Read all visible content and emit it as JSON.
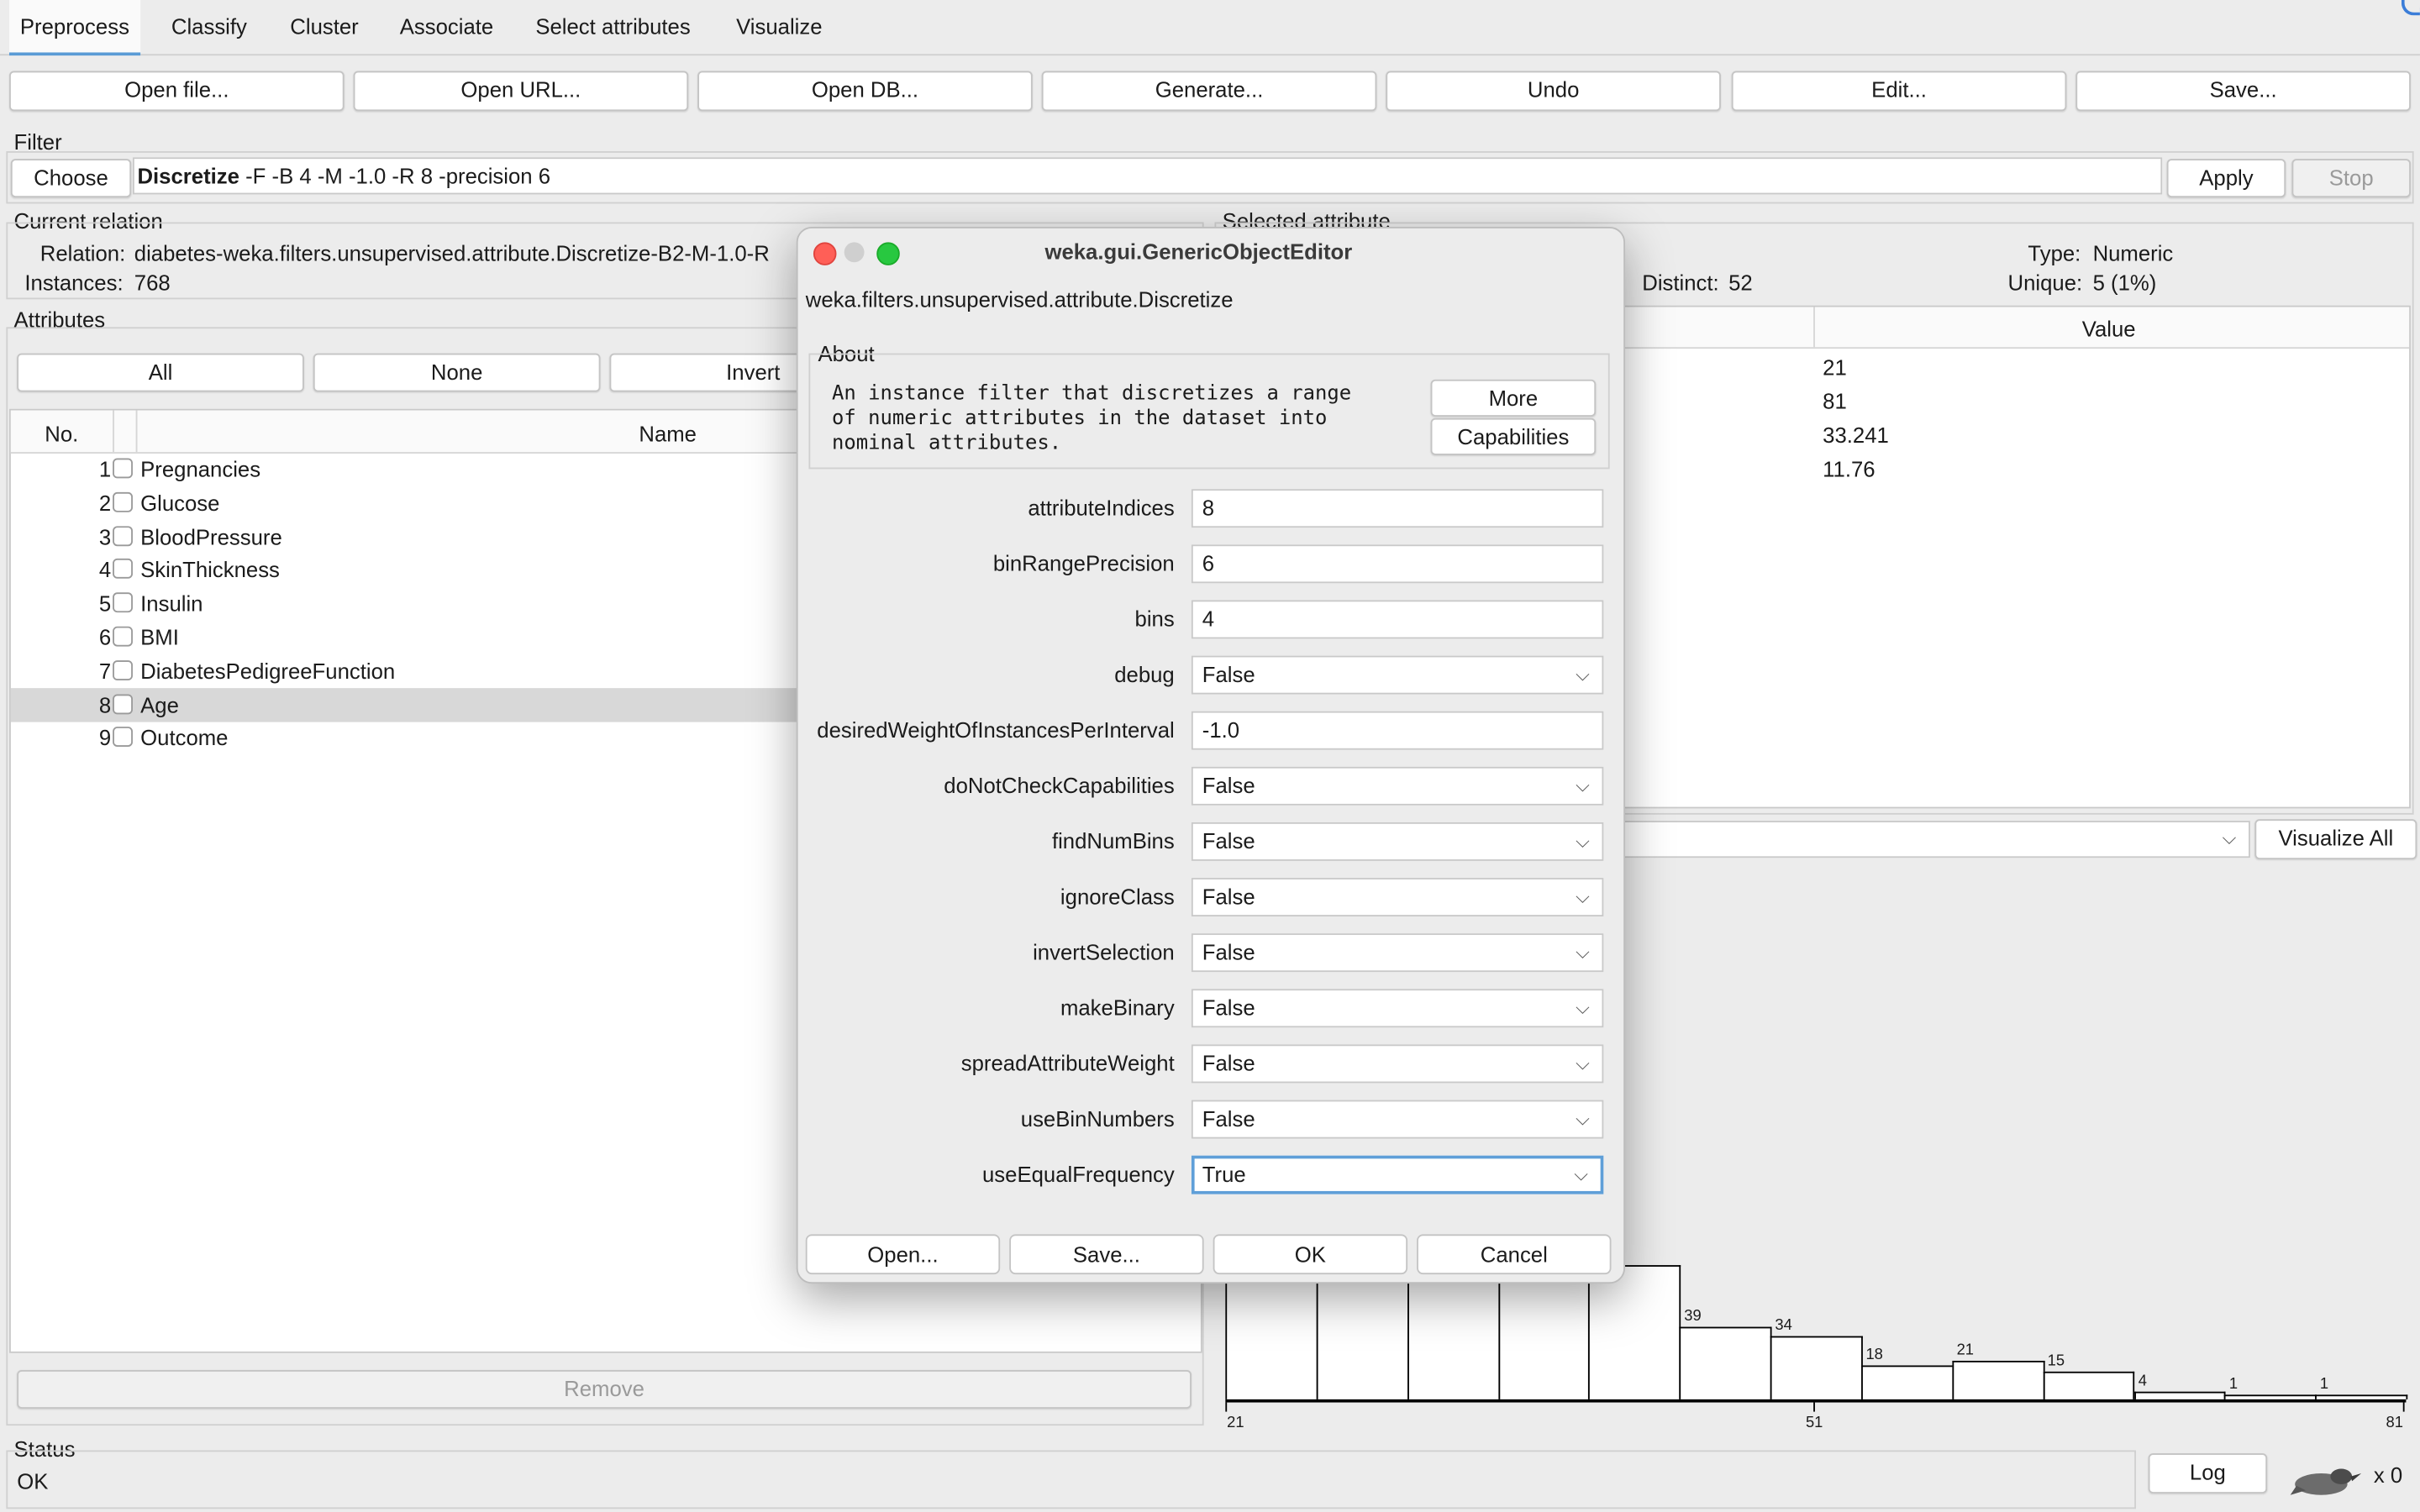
{
  "tabs": [
    "Preprocess",
    "Classify",
    "Cluster",
    "Associate",
    "Select attributes",
    "Visualize"
  ],
  "toolbar": [
    "Open file...",
    "Open URL...",
    "Open DB...",
    "Generate...",
    "Undo",
    "Edit...",
    "Save..."
  ],
  "filter": {
    "section_label": "Filter",
    "choose_label": "Choose",
    "name": "Discretize",
    "options": " -F -B 4 -M -1.0 -R 8 -precision 6",
    "apply_label": "Apply",
    "stop_label": "Stop"
  },
  "current_relation": {
    "title": "Current relation",
    "relation_label": "Relation:",
    "relation_value": "diabetes-weka.filters.unsupervised.attribute.Discretize-B2-M-1.0-R",
    "instances_label": "Instances:",
    "instances_value": "768"
  },
  "attributes": {
    "title": "Attributes",
    "buttons": [
      "All",
      "None",
      "Invert"
    ],
    "col_no": "No.",
    "col_name": "Name",
    "rows": [
      {
        "no": "1",
        "name": "Pregnancies"
      },
      {
        "no": "2",
        "name": "Glucose"
      },
      {
        "no": "3",
        "name": "BloodPressure"
      },
      {
        "no": "4",
        "name": "SkinThickness"
      },
      {
        "no": "5",
        "name": "Insulin"
      },
      {
        "no": "6",
        "name": "BMI"
      },
      {
        "no": "7",
        "name": "DiabetesPedigreeFunction"
      },
      {
        "no": "8",
        "name": "Age"
      },
      {
        "no": "9",
        "name": "Outcome"
      }
    ],
    "selected_index": 7,
    "remove_label": "Remove"
  },
  "selected_attribute": {
    "title": "Selected attribute",
    "distinct_label": "Distinct:",
    "distinct_value": "52",
    "type_label": "Type:",
    "type_value": "Numeric",
    "unique_label": "Unique:",
    "unique_value": "5 (1%)",
    "value_header": "Value",
    "stats_values": [
      "21",
      "81",
      "33.241",
      "11.76"
    ],
    "visualize_all_label": "Visualize All"
  },
  "histogram": {
    "counts": [
      null,
      null,
      null,
      null,
      null,
      39,
      34,
      18,
      21,
      15,
      4,
      1,
      1
    ],
    "axis_ticks": [
      "21",
      "51",
      "81"
    ]
  },
  "status": {
    "title": "Status",
    "text": "OK",
    "log_label": "Log",
    "x_count": "x 0"
  },
  "dialog": {
    "title": "weka.gui.GenericObjectEditor",
    "class_name": "weka.filters.unsupervised.attribute.Discretize",
    "about_title": "About",
    "about_text": "An instance filter that discretizes a range of numeric attributes in the dataset into nominal attributes.",
    "more_label": "More",
    "capabilities_label": "Capabilities",
    "params": [
      {
        "label": "attributeIndices",
        "value": "8",
        "kind": "text"
      },
      {
        "label": "binRangePrecision",
        "value": "6",
        "kind": "text"
      },
      {
        "label": "bins",
        "value": "4",
        "kind": "text"
      },
      {
        "label": "debug",
        "value": "False",
        "kind": "select"
      },
      {
        "label": "desiredWeightOfInstancesPerInterval",
        "value": "-1.0",
        "kind": "text"
      },
      {
        "label": "doNotCheckCapabilities",
        "value": "False",
        "kind": "select"
      },
      {
        "label": "findNumBins",
        "value": "False",
        "kind": "select"
      },
      {
        "label": "ignoreClass",
        "value": "False",
        "kind": "select"
      },
      {
        "label": "invertSelection",
        "value": "False",
        "kind": "select"
      },
      {
        "label": "makeBinary",
        "value": "False",
        "kind": "select"
      },
      {
        "label": "spreadAttributeWeight",
        "value": "False",
        "kind": "select"
      },
      {
        "label": "useBinNumbers",
        "value": "False",
        "kind": "select"
      },
      {
        "label": "useEqualFrequency",
        "value": "True",
        "kind": "select"
      }
    ],
    "buttons": [
      "Open...",
      "Save...",
      "OK",
      "Cancel"
    ]
  }
}
